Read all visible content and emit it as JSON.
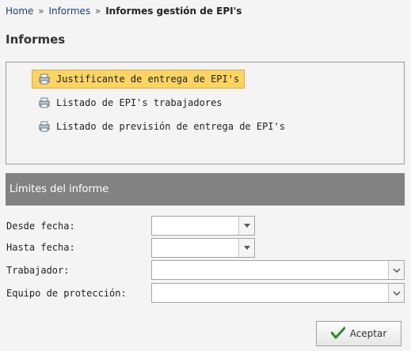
{
  "breadcrumb": {
    "home": "Home",
    "separator": "»",
    "informes": "Informes",
    "current": "Informes gestión de EPI's"
  },
  "page_title": "Informes",
  "reports": {
    "items": [
      {
        "label": "Justificante de entrega de EPI's",
        "selected": true
      },
      {
        "label": "Listado de EPI's trabajadores",
        "selected": false
      },
      {
        "label": "Listado de previsión de entrega de EPI's",
        "selected": false
      }
    ]
  },
  "limits": {
    "title": "Límites del informe",
    "fields": {
      "desde_fecha": {
        "label": "Desde fecha:",
        "value": ""
      },
      "hasta_fecha": {
        "label": "Hasta fecha:",
        "value": ""
      },
      "trabajador": {
        "label": "Trabajador:",
        "value": ""
      },
      "equipo": {
        "label": "Equipo de protección:",
        "value": ""
      }
    }
  },
  "actions": {
    "accept_label": "Aceptar"
  },
  "colors": {
    "selected_bg": "#fbd463",
    "header_bg": "#828282",
    "check_green": "#2f8a2f"
  }
}
